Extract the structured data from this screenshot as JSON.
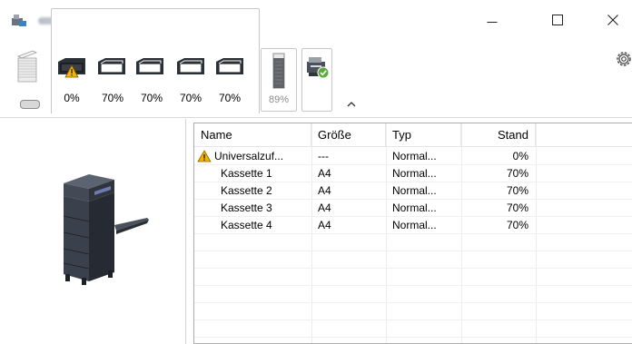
{
  "window": {
    "controls": {
      "minimize": "—",
      "maximize": "☐",
      "close": "✕"
    }
  },
  "toolbar": {
    "input_trays": [
      {
        "level": "0%",
        "status": "warning"
      },
      {
        "level": "70%",
        "status": "ok"
      },
      {
        "level": "70%",
        "status": "ok"
      },
      {
        "level": "70%",
        "status": "ok"
      },
      {
        "level": "70%",
        "status": "ok"
      }
    ],
    "toner": {
      "level": "89%"
    },
    "icons": {
      "paper_stack": "paper-stack-icon",
      "toner": "toner-cartridge-icon",
      "device_status": "device-ok-icon",
      "collapse": "collapse-chevron-icon",
      "settings": "gear-icon"
    }
  },
  "table": {
    "headers": {
      "name": "Name",
      "size": "Größe",
      "type": "Typ",
      "level": "Stand"
    },
    "rows": [
      {
        "name": "Universalzuf...",
        "size": "---",
        "type": "Normal...",
        "level": "0%",
        "warning": true
      },
      {
        "name": "Kassette 1",
        "size": "A4",
        "type": "Normal...",
        "level": "70%",
        "warning": false
      },
      {
        "name": "Kassette 2",
        "size": "A4",
        "type": "Normal...",
        "level": "70%",
        "warning": false
      },
      {
        "name": "Kassette 3",
        "size": "A4",
        "type": "Normal...",
        "level": "70%",
        "warning": false
      },
      {
        "name": "Kassette 4",
        "size": "A4",
        "type": "Normal...",
        "level": "70%",
        "warning": false
      }
    ]
  },
  "colors": {
    "warning": "#f5b400",
    "ok": "#5aab3a",
    "device_dark": "#3f4552",
    "grid": "#ececec"
  }
}
